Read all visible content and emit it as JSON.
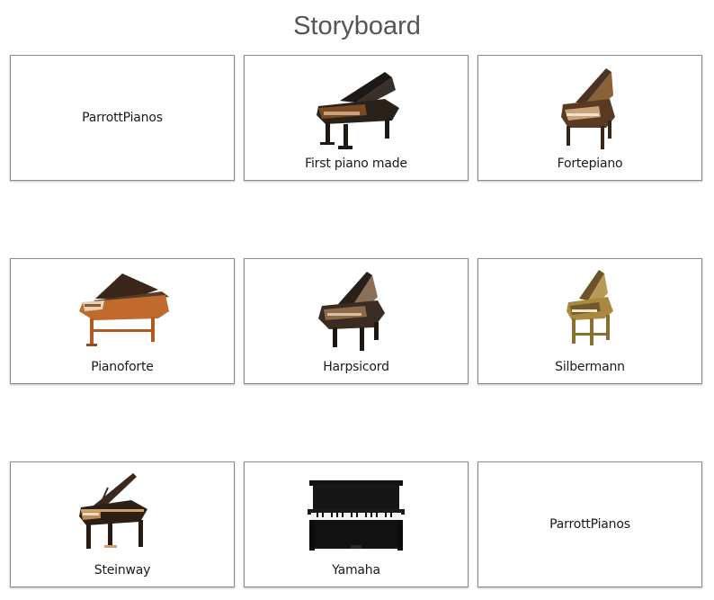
{
  "page": {
    "title": "Storyboard"
  },
  "panels": [
    {
      "caption": "ParrottPianos",
      "image": null
    },
    {
      "caption": "First piano made",
      "image": "grand-piano-dark-antique-icon"
    },
    {
      "caption": "Fortepiano",
      "image": "fortepiano-brown-icon"
    },
    {
      "caption": "Pianoforte",
      "image": "pianoforte-orange-icon"
    },
    {
      "caption": "Harpsicord",
      "image": "harpsichord-dark-icon"
    },
    {
      "caption": "Silbermann",
      "image": "silbermann-piano-gold-icon"
    },
    {
      "caption": "Steinway",
      "image": "steinway-grand-piano-icon"
    },
    {
      "caption": "Yamaha",
      "image": "yamaha-upright-piano-icon"
    },
    {
      "caption": "ParrottPianos",
      "image": null
    }
  ],
  "colors": {
    "title_text": "#555555",
    "panel_border": "#8a8a8a",
    "caption_text": "#1a1a1a",
    "dark_wood": "#2b211b",
    "mid_wood": "#6a4a2a",
    "orange_wood": "#c06a2e",
    "gold_wood": "#a8893e",
    "light_wood": "#cfa06a",
    "black_lacquer": "#111111"
  }
}
